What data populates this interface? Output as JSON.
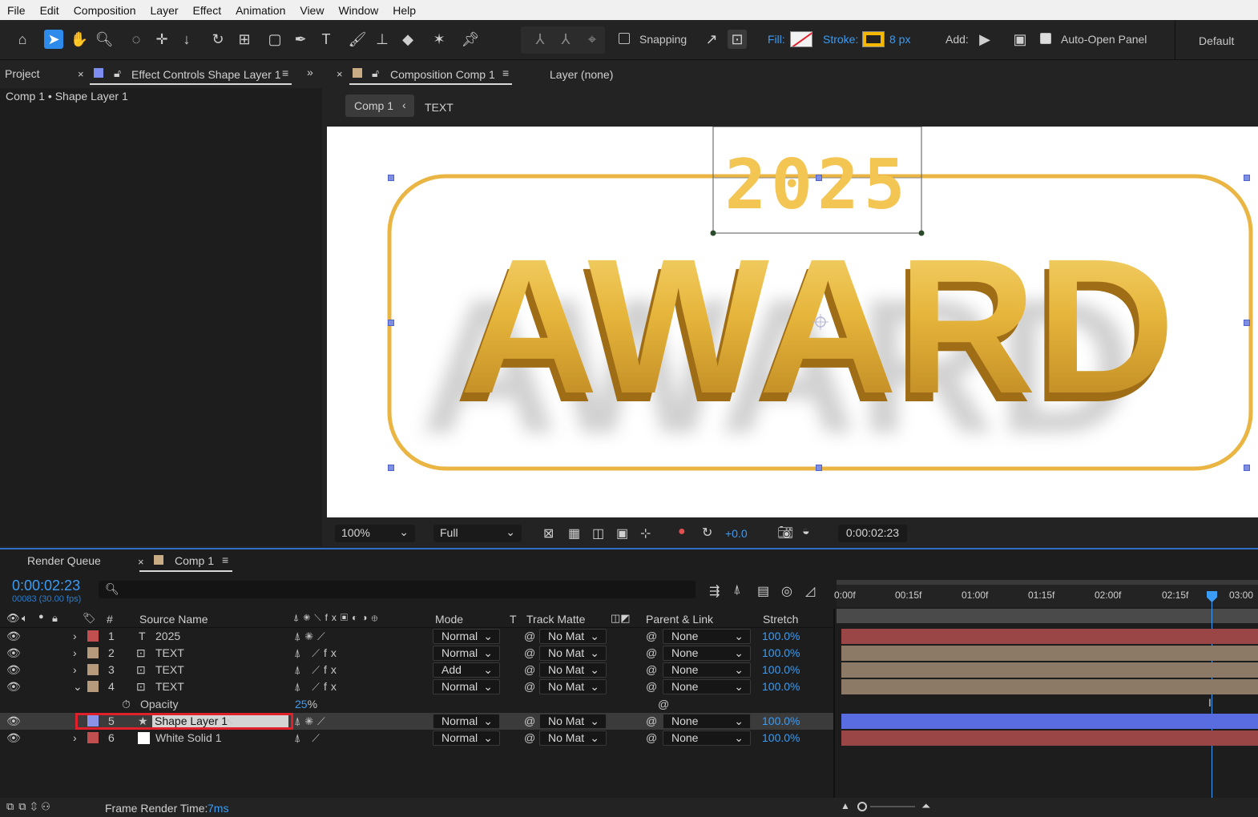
{
  "menu": [
    "File",
    "Edit",
    "Composition",
    "Layer",
    "Effect",
    "Animation",
    "View",
    "Window",
    "Help"
  ],
  "toolbar": {
    "snapping_label": "Snapping",
    "fill_label": "Fill:",
    "stroke_label": "Stroke:",
    "stroke_width": "8 px",
    "add_label": "Add:",
    "auto_open_label": "Auto-Open Panel",
    "workspace": "Default"
  },
  "left_panel": {
    "tab_project": "Project",
    "tab_effect_controls": "Effect Controls Shape Layer 1",
    "breadcrumb": "Comp 1 • Shape Layer 1"
  },
  "comp_panel": {
    "tab_label": "Composition Comp 1",
    "layer_tab": "Layer (none)",
    "crumb_comp": "Comp 1",
    "crumb_layer": "TEXT",
    "canvas_year": "2025",
    "canvas_title": "AWARD"
  },
  "viewer_bar": {
    "zoom": "100%",
    "resolution": "Full",
    "exposure": "+0.0",
    "timecode": "0:00:02:23"
  },
  "timeline": {
    "tab_render_queue": "Render Queue",
    "tab_comp": "Comp 1",
    "timecode": "0:00:02:23",
    "frame_info": "00083 (30.00 fps)",
    "ruler": [
      "0:00f",
      "00:15f",
      "01:00f",
      "01:15f",
      "02:00f",
      "02:15f",
      "03:00"
    ],
    "headers": {
      "num": "#",
      "source": "Source Name",
      "mode": "Mode",
      "t": "T",
      "track_matte": "Track Matte",
      "parent": "Parent & Link",
      "stretch": "Stretch"
    },
    "layers": [
      {
        "num": "1",
        "name": "2025",
        "mode": "Normal",
        "matte": "No Mat",
        "parent": "None",
        "stretch": "100.0%"
      },
      {
        "num": "2",
        "name": "TEXT",
        "mode": "Normal",
        "matte": "No Mat",
        "parent": "None",
        "stretch": "100.0%"
      },
      {
        "num": "3",
        "name": "TEXT",
        "mode": "Add",
        "matte": "No Mat",
        "parent": "None",
        "stretch": "100.0%"
      },
      {
        "num": "4",
        "name": "TEXT",
        "mode": "Normal",
        "matte": "No Mat",
        "parent": "None",
        "stretch": "100.0%"
      },
      {
        "num": "5",
        "name": "Shape Layer 1",
        "mode": "Normal",
        "matte": "No Mat",
        "parent": "None",
        "stretch": "100.0%"
      },
      {
        "num": "6",
        "name": "White Solid 1",
        "mode": "Normal",
        "matte": "No Mat",
        "parent": "None",
        "stretch": "100.0%"
      }
    ],
    "opacity_label": "Opacity",
    "opacity_value": "25",
    "opacity_unit": "%",
    "frame_render_label": "Frame Render Time:",
    "frame_render_value": "7ms"
  },
  "colors": {
    "accent_blue": "#2d8ceb",
    "label_red": "#c24f4f",
    "label_tan": "#b59a7c",
    "label_lavender": "#8a93e8",
    "gold": "#e3b23c",
    "highlight_red": "#e0202a"
  }
}
